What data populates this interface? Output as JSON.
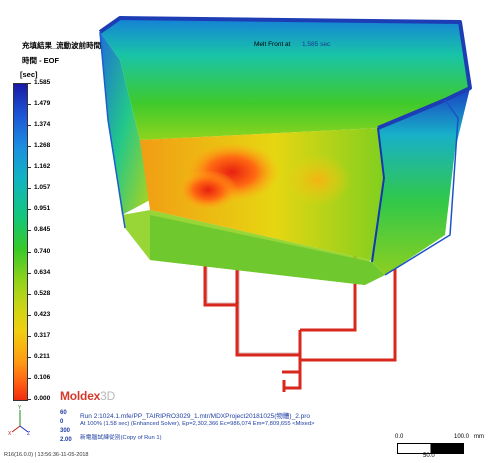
{
  "header": {
    "line1": "充填結果_流動波前時間",
    "line2": "時間 - EOF",
    "unit": "[sec]"
  },
  "legend": {
    "ticks": [
      "1.585",
      "1.479",
      "1.374",
      "1.268",
      "1.162",
      "1.057",
      "0.951",
      "0.845",
      "0.740",
      "0.634",
      "0.528",
      "0.423",
      "0.317",
      "0.211",
      "0.106",
      "0.000"
    ]
  },
  "viewport": {
    "meltfront_label": "Melt Front at",
    "meltfront_value": "1.585 sec"
  },
  "brand": {
    "name": "Moldex",
    "suffix": "3D"
  },
  "stats": {
    "a": "60",
    "b": "0",
    "c": "300",
    "d": "2.00"
  },
  "info": {
    "run_line": "Run 2:1024.1.mfe/PP_TAIRIPRO3029_1.mtr/MDXProject20181025(物體)_2.pro",
    "solver_line": "At 100% (1.58 sec) (Enhanced Solver), Ep=2,302,366 Ec=986,074 Em=7,809,655 <Mixed>",
    "copy_line": "新電腦試練從別(Copy of Run 1)"
  },
  "scale_bar": {
    "l0": "0.0",
    "l100": "100.0",
    "unit": "mm",
    "l50": "50.0"
  },
  "footer": {
    "version": "R16(16.0.0) | 13:56:36-11-05-2018"
  }
}
